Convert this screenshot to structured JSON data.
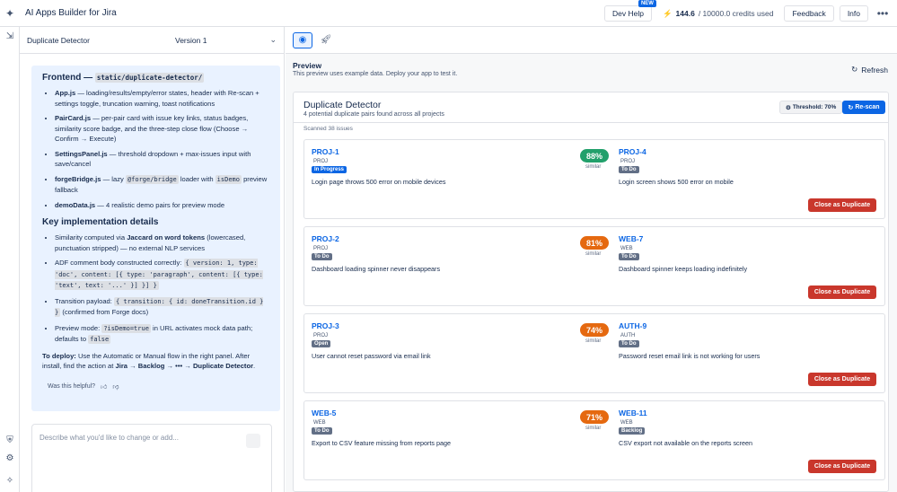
{
  "app": {
    "title": "AI Apps Builder for Jira",
    "logo_icon": "sparkle-icon"
  },
  "topbar": {
    "dev_help": "Dev Help",
    "new_badge": "NEW",
    "credits_used": "144.6",
    "credits_total": "/ 10000.0 credits used",
    "feedback": "Feedback",
    "info": "Info",
    "more": "•••"
  },
  "left": {
    "app_name": "Duplicate Detector",
    "version": "Version 1",
    "message": {
      "frontend_heading": "Frontend —",
      "frontend_path": "static/duplicate-detector/",
      "files": [
        {
          "name": "App.js",
          "desc": " — loading/results/empty/error states, header with Re-scan + settings toggle, truncation warning, toast notifications"
        },
        {
          "name": "PairCard.js",
          "desc": " — per-pair card with issue key links, status badges, similarity score badge, and the three-step close flow (Choose → Confirm → Execute)"
        },
        {
          "name": "SettingsPanel.js",
          "desc": " — threshold dropdown + max-issues input with save/cancel"
        },
        {
          "name": "forgeBridge.js",
          "desc_pre": " — lazy ",
          "code1": "@forge/bridge",
          "desc_mid": " loader with ",
          "code2": "isDemo",
          "desc_post": " preview fallback"
        },
        {
          "name": "demoData.js",
          "desc": " — 4 realistic demo pairs for preview mode"
        }
      ],
      "impl_heading": "Key implementation details",
      "impl": {
        "sim_pre": "Similarity computed via ",
        "sim_bold": "Jaccard on word tokens",
        "sim_post": " (lowercased, punctuation stripped) — no external NLP services",
        "adf_pre": "ADF comment body constructed correctly: ",
        "adf_code": "{ version: 1, type: 'doc', content: [{ type: 'paragraph', content: [{ type: 'text', text: '...' }] }] }",
        "trans_pre": "Transition payload: ",
        "trans_code": "{ transition: { id: doneTransition.id } }",
        "trans_post": " (confirmed from Forge docs)",
        "prev_pre": "Preview mode: ",
        "prev_code": "?isDemo=true",
        "prev_mid": " in URL activates mock data path; defaults to ",
        "prev_code2": "false"
      },
      "deploy_bold": "To deploy:",
      "deploy_text": " Use the Automatic or Manual flow in the right panel. After install, find the action at ",
      "deploy_path": "Jira → Backlog → ••• → Duplicate Detector",
      "deploy_end": ".",
      "helpful": "Was this helpful?"
    },
    "prompt_placeholder": "Describe what you'd like to change or add..."
  },
  "right": {
    "preview_label": "Preview",
    "preview_sub": "This preview uses example data. Deploy your app to test it.",
    "refresh": "Refresh",
    "panel": {
      "title": "Duplicate Detector",
      "subtitle": "4 potential duplicate pairs found across all projects",
      "threshold": "Threshold: 70%",
      "rescan": "Re-scan",
      "scanned": "Scanned 38 issues",
      "similar_label": "similar",
      "close_label": "Close as Duplicate",
      "pairs": [
        {
          "score": "88%",
          "score_color": "#22a06b",
          "a": {
            "key": "PROJ-1",
            "proj": "PROJ",
            "status": "In Progress",
            "status_color": "#0c66e4",
            "summary": "Login page throws 500 error on mobile devices"
          },
          "b": {
            "key": "PROJ-4",
            "proj": "PROJ",
            "status": "To Do",
            "status_color": "#626f86",
            "summary": "Login screen shows 500 error on mobile"
          }
        },
        {
          "score": "81%",
          "score_color": "#e56910",
          "a": {
            "key": "PROJ-2",
            "proj": "PROJ",
            "status": "To Do",
            "status_color": "#626f86",
            "summary": "Dashboard loading spinner never disappears"
          },
          "b": {
            "key": "WEB-7",
            "proj": "WEB",
            "status": "To Do",
            "status_color": "#626f86",
            "summary": "Dashboard spinner keeps loading indefinitely"
          }
        },
        {
          "score": "74%",
          "score_color": "#e56910",
          "a": {
            "key": "PROJ-3",
            "proj": "PROJ",
            "status": "Open",
            "status_color": "#626f86",
            "summary": "User cannot reset password via email link"
          },
          "b": {
            "key": "AUTH-9",
            "proj": "AUTH",
            "status": "To Do",
            "status_color": "#626f86",
            "summary": "Password reset email link is not working for users"
          }
        },
        {
          "score": "71%",
          "score_color": "#e56910",
          "a": {
            "key": "WEB-5",
            "proj": "WEB",
            "status": "To Do",
            "status_color": "#626f86",
            "summary": "Export to CSV feature missing from reports page"
          },
          "b": {
            "key": "WEB-11",
            "proj": "WEB",
            "status": "Backlog",
            "status_color": "#626f86",
            "summary": "CSV export not available on the reports screen"
          }
        }
      ]
    }
  }
}
